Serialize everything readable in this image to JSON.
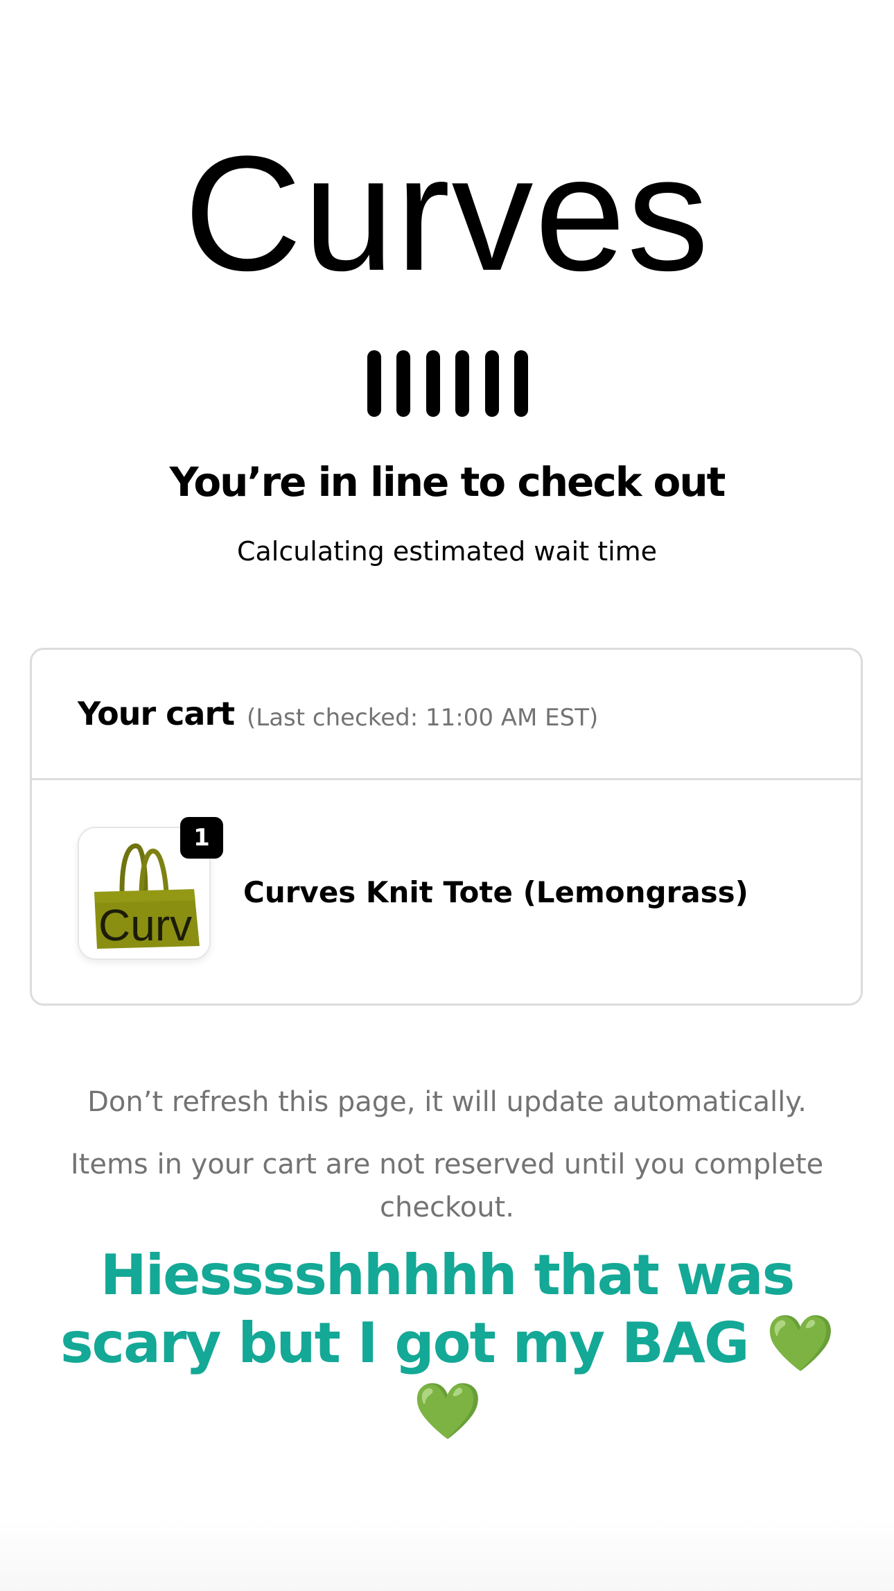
{
  "brand": {
    "name": "Curves"
  },
  "queue": {
    "headline": "You’re in line to check out",
    "status": "Calculating estimated wait time"
  },
  "cart": {
    "title": "Your cart",
    "last_checked": "(Last checked: 11:00 AM EST)",
    "items": [
      {
        "name": "Curves Knit Tote (Lemongrass)",
        "quantity": "1",
        "thumbnail_text": "Curv",
        "thumbnail_color": "#8a8f12"
      }
    ]
  },
  "notices": {
    "refresh": "Don’t refresh this page, it will update automatically.",
    "reserve": "Items in your cart are not reserved until you complete checkout."
  },
  "caption": {
    "text": "Hiesssshhhhh that was scary but I got my BAG 💚💚",
    "color": "#14a896"
  }
}
